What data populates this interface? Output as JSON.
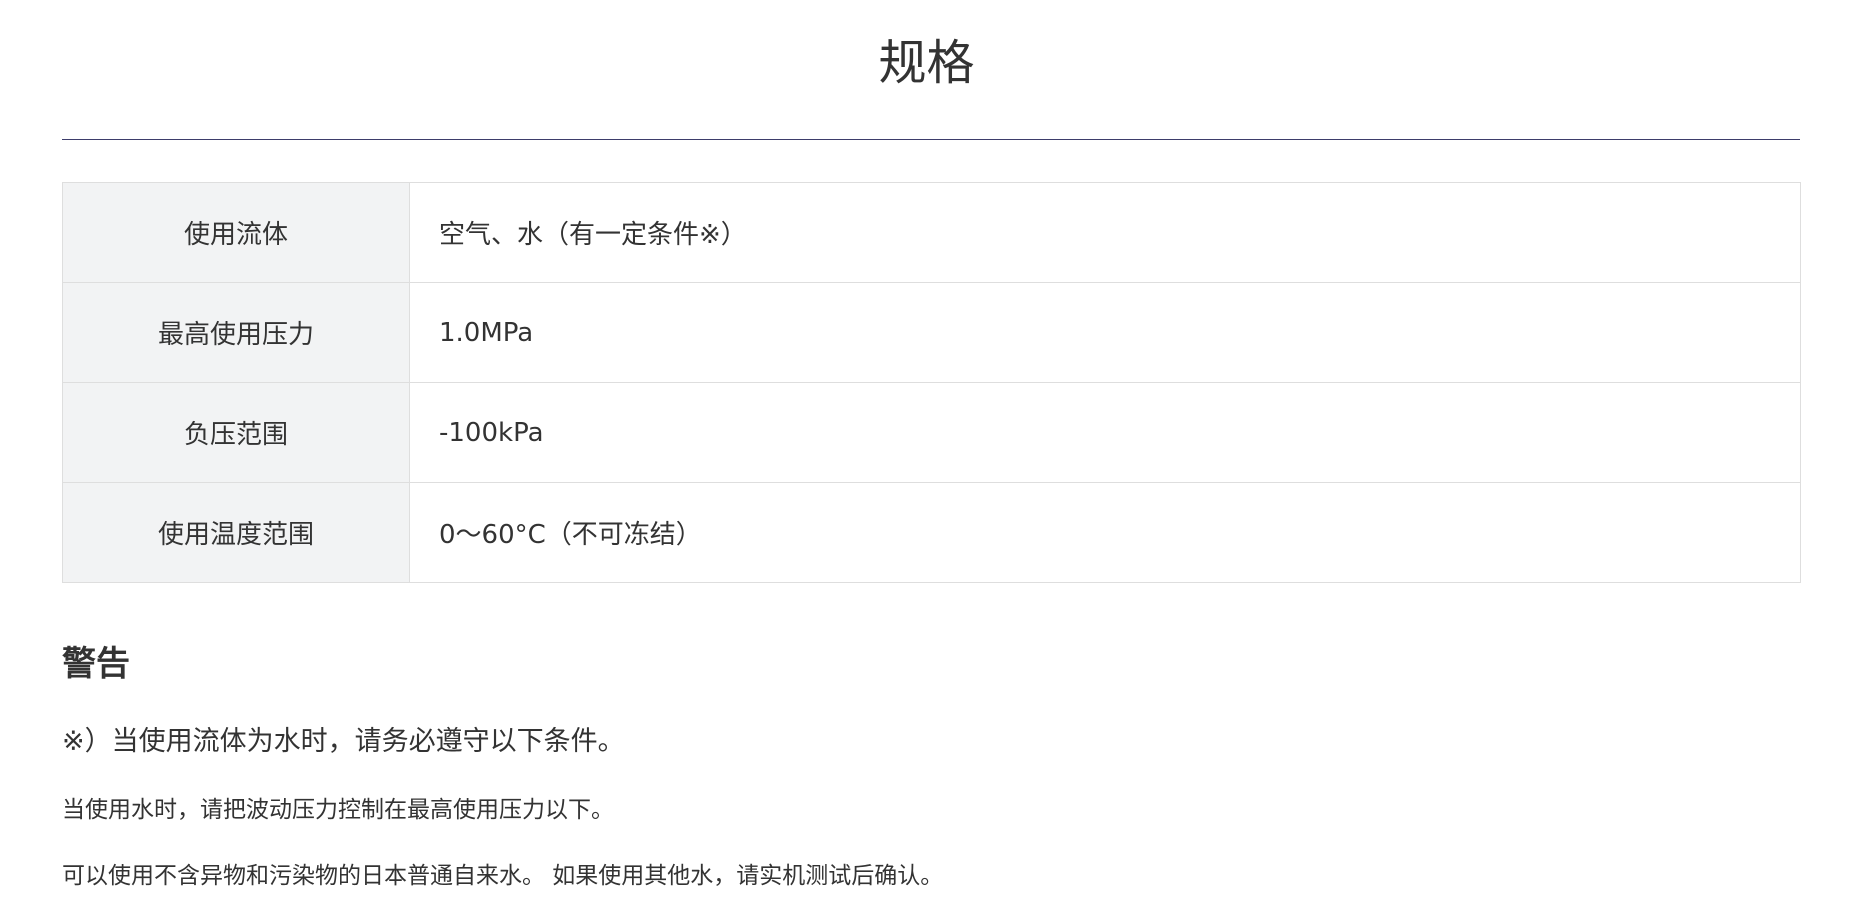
{
  "page": {
    "title": "规格"
  },
  "colors": {
    "rule": "#3d3d6b",
    "label_bg": "#f2f3f4",
    "border": "#dedede",
    "text": "#333333"
  },
  "spec_table": {
    "rows": [
      {
        "label": "使用流体",
        "value": "空气、水（有一定条件※）"
      },
      {
        "label": "最高使用压力",
        "value": "1.0MPa"
      },
      {
        "label": "负压范围",
        "value": "-100kPa"
      },
      {
        "label": "使用温度范围",
        "value": "0～60°C（不可冻结）"
      }
    ]
  },
  "warning": {
    "heading": "警告",
    "lead": "※）当使用流体为水时，请务必遵守以下条件。",
    "lines": [
      "当使用水时，请把波动压力控制在最高使用压力以下。",
      "可以使用不含异物和污染物的日本普通自来水。 如果使用其他水，请实机测试后确认。"
    ]
  }
}
